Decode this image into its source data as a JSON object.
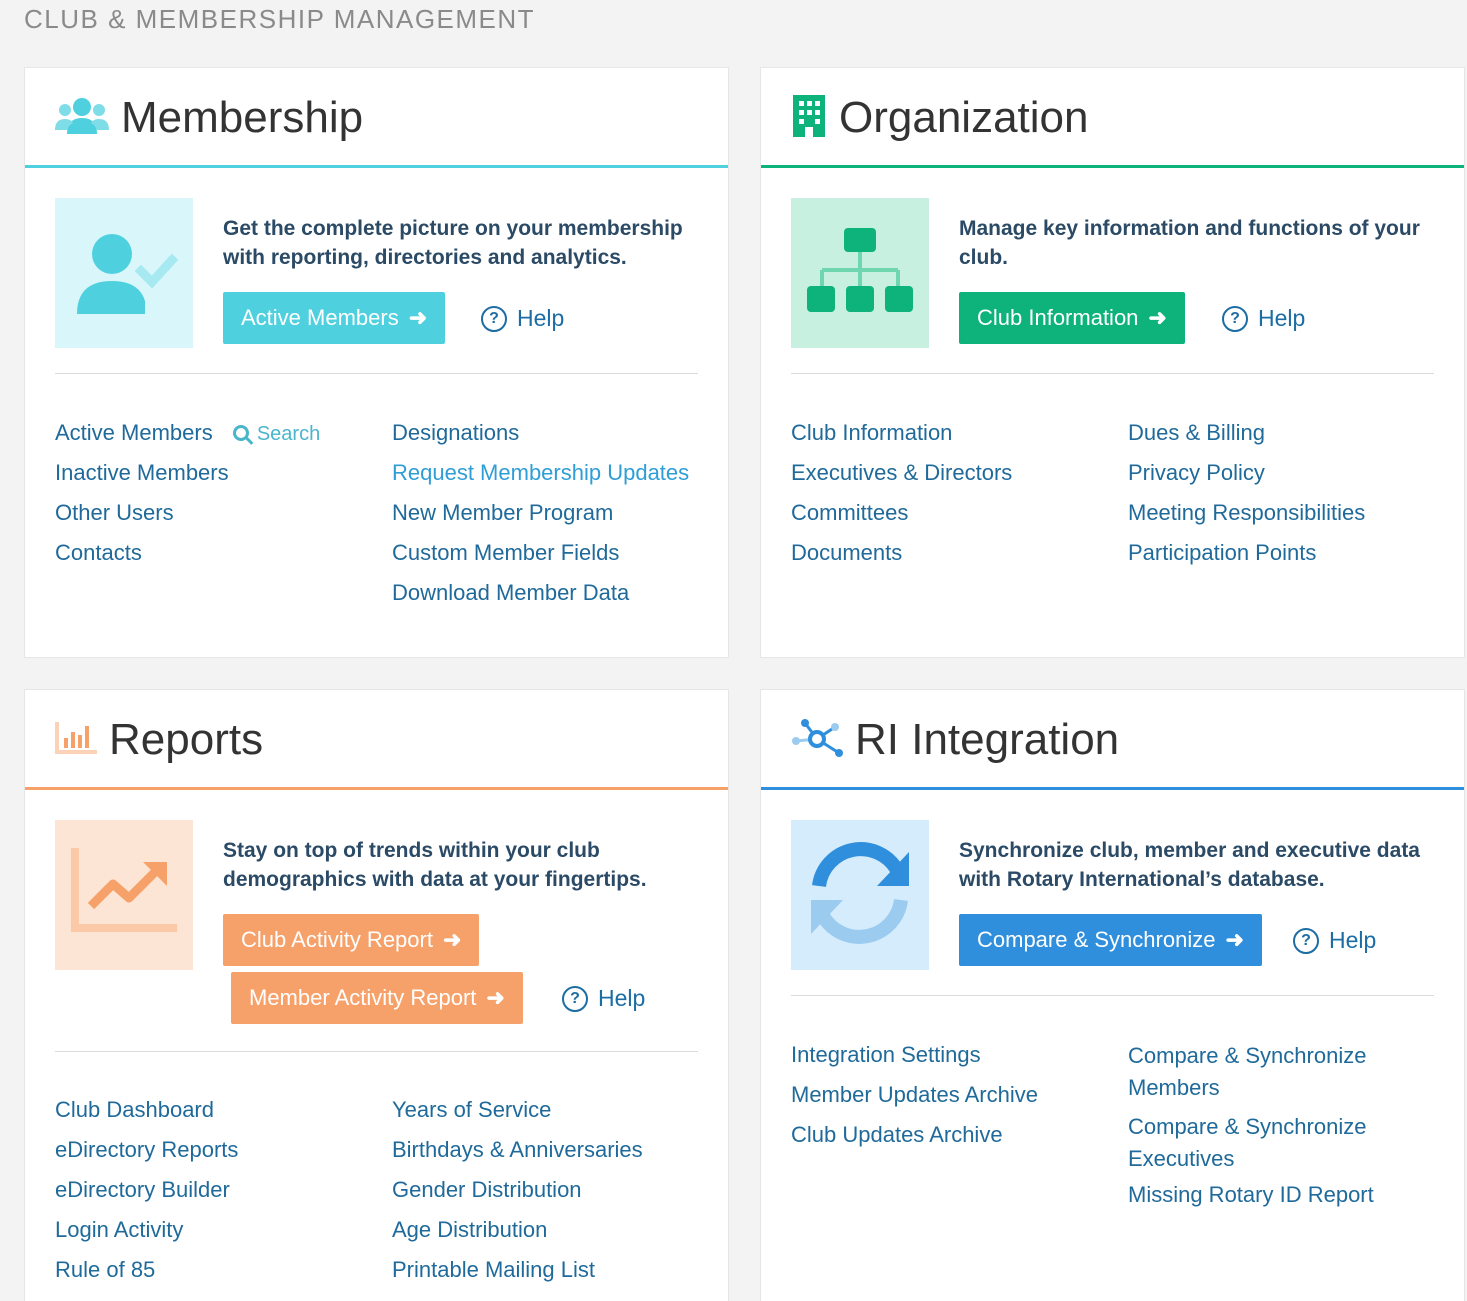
{
  "page": {
    "title": "CLUB & MEMBERSHIP MANAGEMENT"
  },
  "colors": {
    "membership": "#4fd0de",
    "organization": "#0eb37c",
    "reports": "#f7a16a",
    "ri": "#2f8fdc"
  },
  "membership": {
    "title": "Membership",
    "icon": "users-icon",
    "hero_icon": "user-check-icon",
    "description": "Get the complete picture on your membership with reporting, directories and analytics.",
    "button": "Active Members",
    "help": "Help",
    "search_label": "Search",
    "links_left": [
      "Active Members",
      "Inactive Members",
      "Other Users",
      "Contacts"
    ],
    "links_right": [
      "Designations",
      "Request Membership Updates",
      "New Member Program",
      "Custom Member Fields",
      "Download Member Data"
    ]
  },
  "organization": {
    "title": "Organization",
    "icon": "building-icon",
    "hero_icon": "org-chart-icon",
    "description": "Manage key information and functions of your club.",
    "button": "Club Information",
    "help": "Help",
    "links_left": [
      "Club Information",
      "Executives & Directors",
      "Committees",
      "Documents"
    ],
    "links_right": [
      "Dues & Billing",
      "Privacy Policy",
      "Meeting Responsibilities",
      "Participation Points"
    ]
  },
  "reports": {
    "title": "Reports",
    "icon": "bar-chart-icon",
    "hero_icon": "trend-up-icon",
    "description": "Stay on top of trends within your club demographics with data at your fingertips.",
    "button1": "Club Activity Report",
    "button2": "Member Activity Report",
    "help": "Help",
    "links_left": [
      "Club Dashboard",
      "eDirectory Reports",
      "eDirectory Builder",
      "Login Activity",
      "Rule of 85"
    ],
    "links_right": [
      "Years of Service",
      "Birthdays & Anniversaries",
      "Gender Distribution",
      "Age Distribution",
      "Printable Mailing List"
    ]
  },
  "ri": {
    "title": "RI Integration",
    "icon": "network-icon",
    "hero_icon": "sync-icon",
    "description": "Synchronize club, member and executive data with Rotary International’s database.",
    "button": "Compare & Synchronize",
    "help": "Help",
    "links_left": [
      "Integration Settings",
      "Member Updates Archive",
      "Club Updates Archive"
    ],
    "links_right": [
      "Compare & Synchronize Members",
      "Compare & Synchronize Executives",
      "Missing Rotary ID Report"
    ]
  }
}
